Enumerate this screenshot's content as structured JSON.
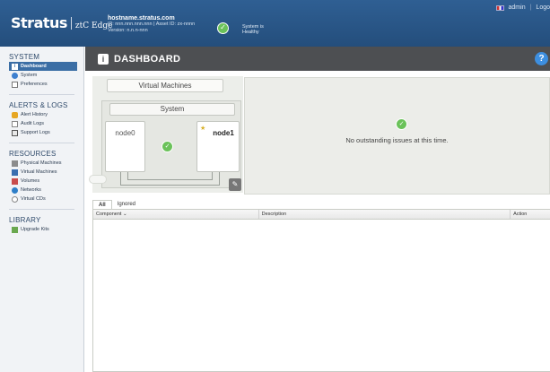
{
  "header": {
    "logo_main": "Stratus",
    "logo_sub": "ztC Edge",
    "hostname": "hostname.stratus.com",
    "ip_line": "IP: nnn.nnn.nnn.nnn | Asset ID: zx-nnnn",
    "version_line": "Version: n.n.n-nnn",
    "health_line1": "System is",
    "health_line2": "Healthy",
    "user": "admin",
    "logout": "Logo"
  },
  "sidebar": {
    "system_title": "SYSTEM",
    "system_items": [
      "Dashboard",
      "System",
      "Preferences"
    ],
    "alerts_title": "ALERTS & LOGS",
    "alerts_items": [
      "Alert History",
      "Audit Logs",
      "Support Logs"
    ],
    "resources_title": "RESOURCES",
    "resources_items": [
      "Physical Machines",
      "Virtual Machines",
      "Volumes",
      "Networks",
      "Virtual CDs"
    ],
    "library_title": "LIBRARY",
    "library_items": [
      "Upgrade Kits"
    ]
  },
  "dashboard": {
    "title": "DASHBOARD",
    "vm_label": "Virtual Machines",
    "system_label": "System",
    "node0": "node0",
    "node1": "node1",
    "status_message": "No outstanding issues at this time."
  },
  "tabs": [
    "All",
    "Ignored"
  ],
  "grid": {
    "columns": [
      "Component ⌄",
      "Description",
      "Action"
    ]
  }
}
